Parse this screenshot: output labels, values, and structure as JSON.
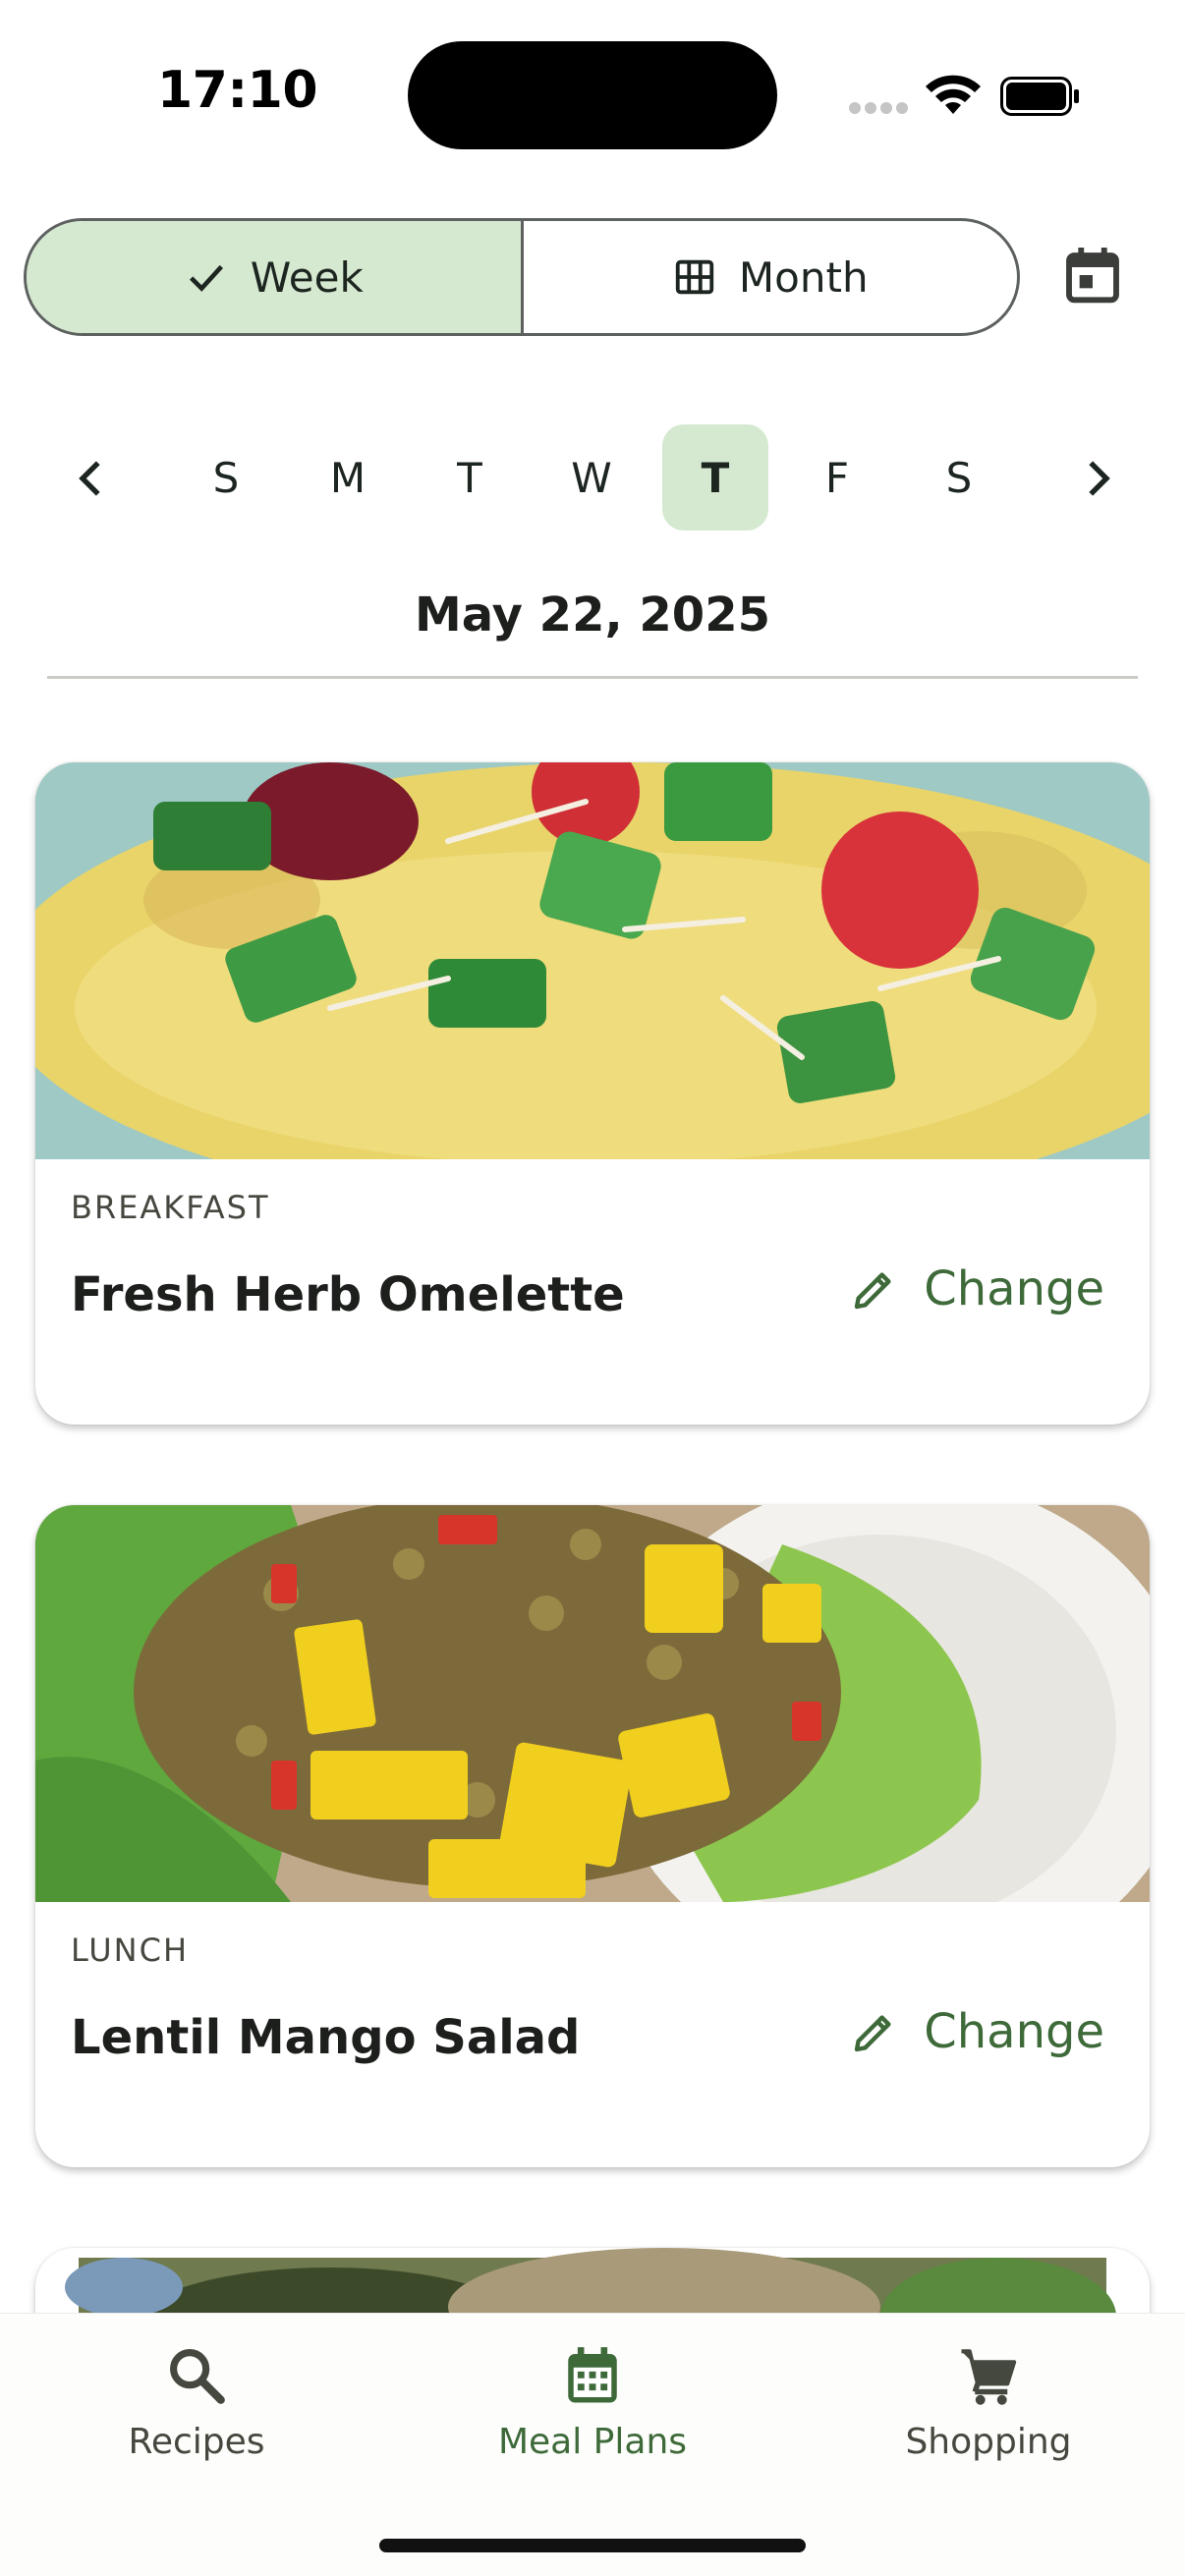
{
  "status_bar": {
    "time": "17:10",
    "icons": [
      "cellular-signal-icon",
      "wifi-icon",
      "battery-icon"
    ]
  },
  "view_toggle": {
    "options": [
      {
        "label": "Week",
        "icon": "check-icon",
        "selected": true
      },
      {
        "label": "Month",
        "icon": "grid-icon",
        "selected": false
      }
    ],
    "calendar_icon": "calendar-today-icon"
  },
  "week": {
    "days": [
      "S",
      "M",
      "T",
      "W",
      "T",
      "F",
      "S"
    ],
    "selected_index": 4,
    "prev_icon": "chevron-left-icon",
    "next_icon": "chevron-right-icon"
  },
  "selected_date": "May 22, 2025",
  "meals": [
    {
      "type": "BREAKFAST",
      "name": "Fresh Herb Omelette",
      "action_label": "Change",
      "action_icon": "pencil-icon"
    },
    {
      "type": "LUNCH",
      "name": "Lentil Mango Salad",
      "action_label": "Change",
      "action_icon": "pencil-icon"
    }
  ],
  "bottom_nav": {
    "items": [
      {
        "label": "Recipes",
        "icon": "search-icon",
        "active": false
      },
      {
        "label": "Meal Plans",
        "icon": "calendar-icon",
        "active": true
      },
      {
        "label": "Shopping",
        "icon": "cart-icon",
        "active": false
      }
    ]
  },
  "colors": {
    "accent": "#3e6a3a",
    "selected_bg": "#d5e8d0",
    "outline": "#5d6160"
  }
}
